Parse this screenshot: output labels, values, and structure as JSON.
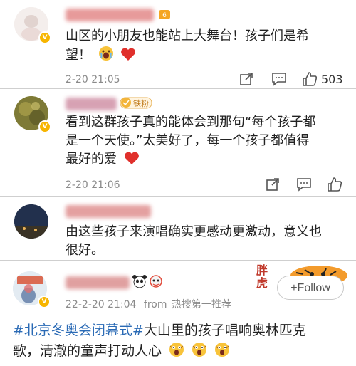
{
  "comments": [
    {
      "username": "",
      "text_line1": "山区的小朋友也能站上大舞台！孩子们是希",
      "text_line2": "望！",
      "time": "2-20 21:05",
      "like_count": "503"
    },
    {
      "username": "",
      "fan_badge": "铁粉",
      "text_line1": "看到这群孩子真的能体会到那句“每个孩子都",
      "text_line2": "是一个天使。”太美好了，每一个孩子都值得",
      "text_line3": "最好的爱",
      "time": "2-20 21:06"
    },
    {
      "username": "",
      "text_line1": "由这些孩子来演唱确实更感动更激动，意义也",
      "text_line2": "很好。"
    }
  ],
  "post": {
    "username": "",
    "follow_label": "+Follow",
    "time": "22-2-20 21:04",
    "from_label": "from",
    "source": "热搜第一推荐",
    "hashtag": "#北京冬奥会闭幕式#",
    "text_line1_rest": "大山里的孩子唱响奥林匹克",
    "text_line2": "歌，清澈的童声打动人心",
    "sticker_text": "胖虎"
  },
  "colors": {
    "link_blue": "#2a6ab5",
    "verified_gold": "#f7b500",
    "heart_red": "#e0302c"
  }
}
